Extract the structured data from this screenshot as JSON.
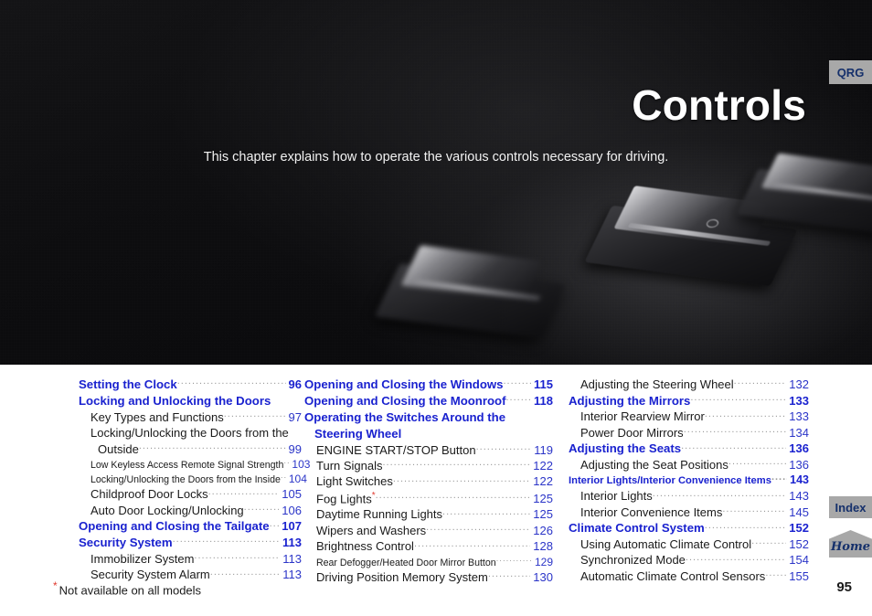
{
  "hero": {
    "title": "Controls",
    "subtitle": "This chapter explains how to operate the various controls necessary for driving.",
    "background_color": "#0b0b0c",
    "image_description": "car-rocker-switches-photo"
  },
  "tabs": {
    "qrg": "QRG",
    "index": "Index",
    "home": "Home",
    "background_color": "#a8a8a8",
    "text_color": "#15306b"
  },
  "colors": {
    "heading_blue": "#1a22cf",
    "page_number_blue": "#2b35c8",
    "body_black": "#1a1a1a",
    "asterisk_red": "#e03a2f",
    "leader_gray": "#9b9b9b"
  },
  "toc": {
    "columns": [
      {
        "entries": [
          {
            "level": "h",
            "text": "Setting the Clock",
            "page": "96"
          },
          {
            "level": "h",
            "text": "Locking and Unlocking the Doors",
            "page": ""
          },
          {
            "level": "1",
            "text": "Key Types and Functions",
            "page": "97"
          },
          {
            "level": "1c",
            "text": "Locking/Unlocking the Doors from the",
            "text2": "Outside",
            "page": "99"
          },
          {
            "level": "2",
            "text": "Low Keyless Access Remote Signal Strength",
            "page": "103"
          },
          {
            "level": "2",
            "text": "Locking/Unlocking the Doors from the Inside",
            "page": "104"
          },
          {
            "level": "1",
            "text": "Childproof Door Locks",
            "page": "105"
          },
          {
            "level": "1",
            "text": "Auto Door Locking/Unlocking",
            "page": "106"
          },
          {
            "level": "h",
            "text": "Opening and Closing the Tailgate",
            "page": "107"
          },
          {
            "level": "h",
            "text": "Security System",
            "page": "113"
          },
          {
            "level": "1",
            "text": "Immobilizer System",
            "page": "113"
          },
          {
            "level": "1",
            "text": "Security System Alarm",
            "page": "113"
          }
        ]
      },
      {
        "entries": [
          {
            "level": "h",
            "text": "Opening and Closing the Windows",
            "page": "115"
          },
          {
            "level": "h",
            "text": "Opening and Closing the Moonroof",
            "page": "118"
          },
          {
            "level": "hw",
            "text": "Operating the Switches Around the",
            "text2": "Steering Wheel",
            "page": ""
          },
          {
            "level": "1",
            "text": "ENGINE START/STOP Button",
            "page": "119"
          },
          {
            "level": "1",
            "text": "Turn Signals",
            "page": "122"
          },
          {
            "level": "1",
            "text": "Light Switches",
            "page": "122"
          },
          {
            "level": "1",
            "text": "Fog Lights",
            "asterisk": true,
            "page": "125"
          },
          {
            "level": "1",
            "text": "Daytime Running Lights",
            "page": "125"
          },
          {
            "level": "1",
            "text": "Wipers and Washers",
            "page": "126"
          },
          {
            "level": "1",
            "text": "Brightness Control",
            "page": "128"
          },
          {
            "level": "2",
            "text": "Rear Defogger/Heated Door Mirror Button",
            "page": "129"
          },
          {
            "level": "1",
            "text": "Driving Position Memory System",
            "page": "130"
          }
        ]
      },
      {
        "entries": [
          {
            "level": "1",
            "text": "Adjusting the Steering Wheel",
            "page": "132"
          },
          {
            "level": "h",
            "text": "Adjusting the Mirrors",
            "page": "133"
          },
          {
            "level": "1",
            "text": "Interior Rearview Mirror",
            "page": "133"
          },
          {
            "level": "1",
            "text": "Power Door Mirrors",
            "page": "134"
          },
          {
            "level": "h",
            "text": "Adjusting the Seats",
            "page": "136"
          },
          {
            "level": "1",
            "text": "Adjusting the Seat Positions",
            "page": "136"
          },
          {
            "level": "hs",
            "text": "Interior Lights/Interior Convenience Items",
            "page": "143"
          },
          {
            "level": "1",
            "text": "Interior Lights",
            "page": "143"
          },
          {
            "level": "1",
            "text": "Interior Convenience Items",
            "page": "145"
          },
          {
            "level": "h",
            "text": "Climate Control System",
            "page": "152"
          },
          {
            "level": "1",
            "text": "Using Automatic Climate Control",
            "page": "152"
          },
          {
            "level": "1",
            "text": "Synchronized Mode",
            "page": "154"
          },
          {
            "level": "1",
            "text": "Automatic Climate Control Sensors",
            "page": "155"
          }
        ]
      }
    ]
  },
  "footer": {
    "asterisk": "*",
    "note": "Not available on all models",
    "page_number": "95"
  }
}
